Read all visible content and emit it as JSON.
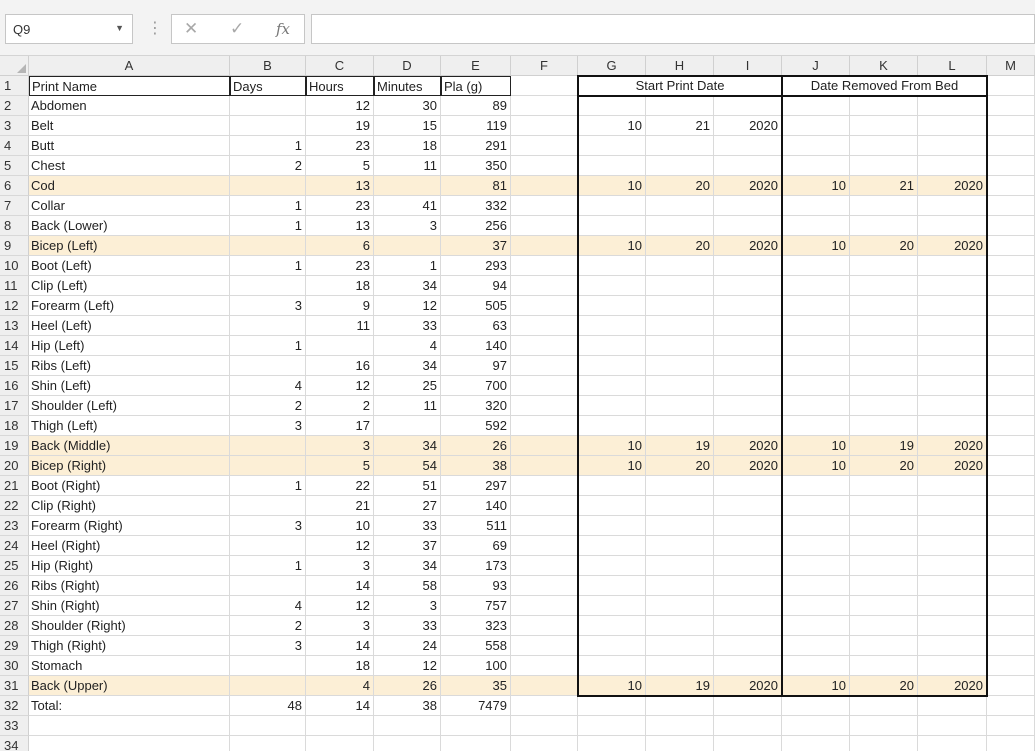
{
  "formula_bar": {
    "name_box": "Q9",
    "cancel_icon": "cancel-x-icon",
    "enter_icon": "check-icon",
    "function_icon": "fx-icon",
    "fx_label": "fx",
    "formula": ""
  },
  "columns": [
    "A",
    "B",
    "C",
    "D",
    "E",
    "F",
    "G",
    "H",
    "I",
    "J",
    "K",
    "L",
    "M"
  ],
  "row_numbers": [
    "1",
    "2",
    "3",
    "4",
    "5",
    "6",
    "7",
    "8",
    "9",
    "10",
    "11",
    "12",
    "13",
    "14",
    "15",
    "16",
    "17",
    "18",
    "19",
    "20",
    "21",
    "22",
    "23",
    "24",
    "25",
    "26",
    "27",
    "28",
    "29",
    "30",
    "31",
    "32",
    "33",
    "34"
  ],
  "headers": {
    "print_name": "Print Name",
    "days": "Days",
    "hours": "Hours",
    "minutes": "Minutes",
    "pla": "Pla (g)",
    "start_print_date": "Start Print Date",
    "date_removed": "Date Removed From Bed"
  },
  "rows": [
    {
      "name": "Abdomen",
      "days": "",
      "hours": "12",
      "minutes": "30",
      "pla": "89",
      "g": "",
      "h": "",
      "i": "",
      "j": "",
      "k": "",
      "l": "",
      "hl": false
    },
    {
      "name": "Belt",
      "days": "",
      "hours": "19",
      "minutes": "15",
      "pla": "119",
      "g": "10",
      "h": "21",
      "i": "2020",
      "j": "",
      "k": "",
      "l": "",
      "hl": false
    },
    {
      "name": "Butt",
      "days": "1",
      "hours": "23",
      "minutes": "18",
      "pla": "291",
      "g": "",
      "h": "",
      "i": "",
      "j": "",
      "k": "",
      "l": "",
      "hl": false
    },
    {
      "name": "Chest",
      "days": "2",
      "hours": "5",
      "minutes": "11",
      "pla": "350",
      "g": "",
      "h": "",
      "i": "",
      "j": "",
      "k": "",
      "l": "",
      "hl": false
    },
    {
      "name": "Cod",
      "days": "",
      "hours": "13",
      "minutes": "",
      "pla": "81",
      "g": "10",
      "h": "20",
      "i": "2020",
      "j": "10",
      "k": "21",
      "l": "2020",
      "hl": true
    },
    {
      "name": "Collar",
      "days": "1",
      "hours": "23",
      "minutes": "41",
      "pla": "332",
      "g": "",
      "h": "",
      "i": "",
      "j": "",
      "k": "",
      "l": "",
      "hl": false
    },
    {
      "name": "Back (Lower)",
      "days": "1",
      "hours": "13",
      "minutes": "3",
      "pla": "256",
      "g": "",
      "h": "",
      "i": "",
      "j": "",
      "k": "",
      "l": "",
      "hl": false
    },
    {
      "name": "Bicep (Left)",
      "days": "",
      "hours": "6",
      "minutes": "",
      "pla": "37",
      "g": "10",
      "h": "20",
      "i": "2020",
      "j": "10",
      "k": "20",
      "l": "2020",
      "hl": true
    },
    {
      "name": "Boot (Left)",
      "days": "1",
      "hours": "23",
      "minutes": "1",
      "pla": "293",
      "g": "",
      "h": "",
      "i": "",
      "j": "",
      "k": "",
      "l": "",
      "hl": false
    },
    {
      "name": "Clip (Left)",
      "days": "",
      "hours": "18",
      "minutes": "34",
      "pla": "94",
      "g": "",
      "h": "",
      "i": "",
      "j": "",
      "k": "",
      "l": "",
      "hl": false
    },
    {
      "name": "Forearm (Left)",
      "days": "3",
      "hours": "9",
      "minutes": "12",
      "pla": "505",
      "g": "",
      "h": "",
      "i": "",
      "j": "",
      "k": "",
      "l": "",
      "hl": false
    },
    {
      "name": "Heel (Left)",
      "days": "",
      "hours": "11",
      "minutes": "33",
      "pla": "63",
      "g": "",
      "h": "",
      "i": "",
      "j": "",
      "k": "",
      "l": "",
      "hl": false
    },
    {
      "name": "Hip (Left)",
      "days": "1",
      "hours": "",
      "minutes": "4",
      "pla": "140",
      "g": "",
      "h": "",
      "i": "",
      "j": "",
      "k": "",
      "l": "",
      "hl": false
    },
    {
      "name": "Ribs (Left)",
      "days": "",
      "hours": "16",
      "minutes": "34",
      "pla": "97",
      "g": "",
      "h": "",
      "i": "",
      "j": "",
      "k": "",
      "l": "",
      "hl": false
    },
    {
      "name": "Shin (Left)",
      "days": "4",
      "hours": "12",
      "minutes": "25",
      "pla": "700",
      "g": "",
      "h": "",
      "i": "",
      "j": "",
      "k": "",
      "l": "",
      "hl": false
    },
    {
      "name": "Shoulder (Left)",
      "days": "2",
      "hours": "2",
      "minutes": "11",
      "pla": "320",
      "g": "",
      "h": "",
      "i": "",
      "j": "",
      "k": "",
      "l": "",
      "hl": false
    },
    {
      "name": "Thigh (Left)",
      "days": "3",
      "hours": "17",
      "minutes": "",
      "pla": "592",
      "g": "",
      "h": "",
      "i": "",
      "j": "",
      "k": "",
      "l": "",
      "hl": false
    },
    {
      "name": "Back (Middle)",
      "days": "",
      "hours": "3",
      "minutes": "34",
      "pla": "26",
      "g": "10",
      "h": "19",
      "i": "2020",
      "j": "10",
      "k": "19",
      "l": "2020",
      "hl": true
    },
    {
      "name": "Bicep (Right)",
      "days": "",
      "hours": "5",
      "minutes": "54",
      "pla": "38",
      "g": "10",
      "h": "20",
      "i": "2020",
      "j": "10",
      "k": "20",
      "l": "2020",
      "hl": true
    },
    {
      "name": "Boot (Right)",
      "days": "1",
      "hours": "22",
      "minutes": "51",
      "pla": "297",
      "g": "",
      "h": "",
      "i": "",
      "j": "",
      "k": "",
      "l": "",
      "hl": false
    },
    {
      "name": "Clip (Right)",
      "days": "",
      "hours": "21",
      "minutes": "27",
      "pla": "140",
      "g": "",
      "h": "",
      "i": "",
      "j": "",
      "k": "",
      "l": "",
      "hl": false
    },
    {
      "name": "Forearm (Right)",
      "days": "3",
      "hours": "10",
      "minutes": "33",
      "pla": "511",
      "g": "",
      "h": "",
      "i": "",
      "j": "",
      "k": "",
      "l": "",
      "hl": false
    },
    {
      "name": "Heel (Right)",
      "days": "",
      "hours": "12",
      "minutes": "37",
      "pla": "69",
      "g": "",
      "h": "",
      "i": "",
      "j": "",
      "k": "",
      "l": "",
      "hl": false
    },
    {
      "name": "Hip (Right)",
      "days": "1",
      "hours": "3",
      "minutes": "34",
      "pla": "173",
      "g": "",
      "h": "",
      "i": "",
      "j": "",
      "k": "",
      "l": "",
      "hl": false
    },
    {
      "name": "Ribs (Right)",
      "days": "",
      "hours": "14",
      "minutes": "58",
      "pla": "93",
      "g": "",
      "h": "",
      "i": "",
      "j": "",
      "k": "",
      "l": "",
      "hl": false
    },
    {
      "name": "Shin (Right)",
      "days": "4",
      "hours": "12",
      "minutes": "3",
      "pla": "757",
      "g": "",
      "h": "",
      "i": "",
      "j": "",
      "k": "",
      "l": "",
      "hl": false
    },
    {
      "name": "Shoulder (Right)",
      "days": "2",
      "hours": "3",
      "minutes": "33",
      "pla": "323",
      "g": "",
      "h": "",
      "i": "",
      "j": "",
      "k": "",
      "l": "",
      "hl": false
    },
    {
      "name": "Thigh (Right)",
      "days": "3",
      "hours": "14",
      "minutes": "24",
      "pla": "558",
      "g": "",
      "h": "",
      "i": "",
      "j": "",
      "k": "",
      "l": "",
      "hl": false
    },
    {
      "name": "Stomach",
      "days": "",
      "hours": "18",
      "minutes": "12",
      "pla": "100",
      "g": "",
      "h": "",
      "i": "",
      "j": "",
      "k": "",
      "l": "",
      "hl": false
    },
    {
      "name": "Back (Upper)",
      "days": "",
      "hours": "4",
      "minutes": "26",
      "pla": "35",
      "g": "10",
      "h": "19",
      "i": "2020",
      "j": "10",
      "k": "20",
      "l": "2020",
      "hl": true
    },
    {
      "name": "Total:",
      "days": "48",
      "hours": "14",
      "minutes": "38",
      "pla": "7479",
      "g": "",
      "h": "",
      "i": "",
      "j": "",
      "k": "",
      "l": "",
      "hl": false
    }
  ],
  "colors": {
    "highlight": "#fcefd6",
    "header_bg": "#efefef",
    "gridline": "#dadada",
    "border": "#111111"
  }
}
